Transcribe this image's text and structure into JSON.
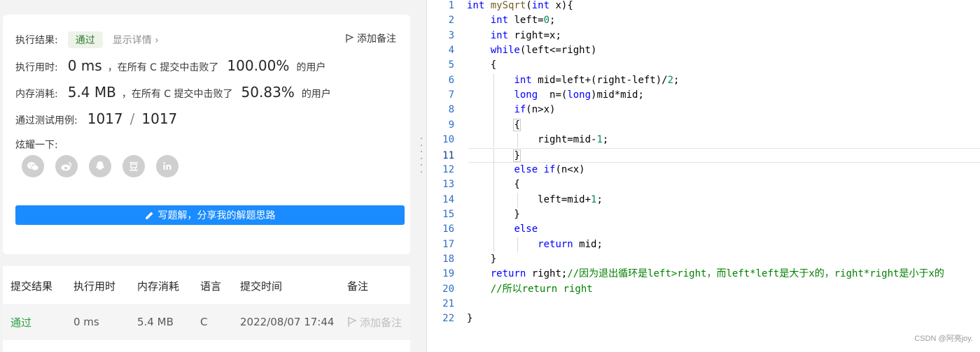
{
  "result": {
    "status_label": "执行结果:",
    "status_value": "通过",
    "detail_link": "显示详情 ›",
    "add_note": "添加备注",
    "runtime_label": "执行用时:",
    "runtime_value": "0 ms",
    "runtime_text": "，在所有 C 提交中击败了",
    "runtime_percent": "100.00%",
    "runtime_suffix": "的用户",
    "memory_label": "内存消耗:",
    "memory_value": "5.4 MB",
    "memory_text": "，在所有 C 提交中击败了",
    "memory_percent": "50.83%",
    "memory_suffix": "的用户",
    "tests_label": "通过测试用例:",
    "tests_passed": "1017",
    "tests_sep": "/",
    "tests_total": "1017",
    "share_label": "炫耀一下:",
    "share_icons": [
      "wechat-icon",
      "weibo-icon",
      "qq-icon",
      "douban-icon",
      "linkedin-icon"
    ],
    "write_button": "写题解，分享我的解题思路"
  },
  "submissions": {
    "headers": [
      "提交结果",
      "执行用时",
      "内存消耗",
      "语言",
      "提交时间",
      "备注"
    ],
    "rows": [
      {
        "result": "通过",
        "runtime": "0 ms",
        "memory": "5.4 MB",
        "language": "C",
        "time": "2022/08/07 17:44",
        "note": "添加备注"
      }
    ]
  },
  "editor": {
    "line_numbers": [
      "1",
      "2",
      "3",
      "4",
      "5",
      "6",
      "7",
      "8",
      "9",
      "10",
      "11",
      "12",
      "13",
      "14",
      "15",
      "16",
      "17",
      "18",
      "19",
      "20",
      "21",
      "22"
    ],
    "active_line": "11",
    "colors": {
      "keyword": "#0000ff",
      "number": "#098658",
      "comment": "#008000",
      "line_number": "#2b6fc7"
    }
  },
  "watermark": "CSDN @阿亮joy."
}
